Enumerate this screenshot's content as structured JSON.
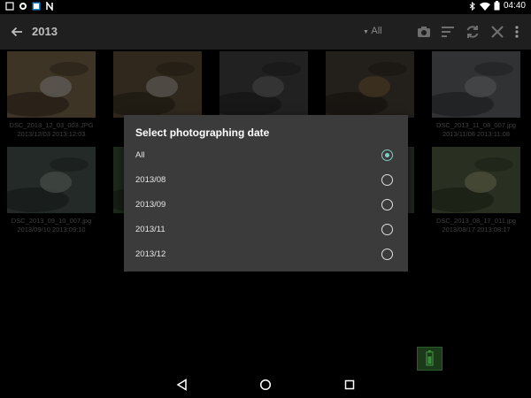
{
  "status_bar": {
    "time": "04:40",
    "left_icons": [
      "square-outline-icon",
      "cast-icon",
      "image-notification-icon",
      "nfc-icon"
    ],
    "right_icons": [
      "bluetooth-icon",
      "wifi-icon",
      "battery-icon"
    ]
  },
  "app_bar": {
    "title": "2013",
    "filter_label": "All",
    "icons": [
      "camera-icon",
      "sort-icon",
      "sync-icon",
      "close-icon",
      "more-vert-icon"
    ]
  },
  "photos": [
    {
      "file": "DSC_2013_12_03_003.JPG",
      "datetime": "2013/12/03 2013:12:03",
      "colors": [
        "#8a7452",
        "#c9c3b6",
        "#4a3c2a"
      ]
    },
    {
      "file": "",
      "datetime": "",
      "colors": [
        "#6b5a41",
        "#b8b2a6",
        "#3d3224"
      ]
    },
    {
      "file": "",
      "datetime": "",
      "colors": [
        "#4a4a4a",
        "#7a7a7a",
        "#2b2b2b"
      ]
    },
    {
      "file": "",
      "datetime": "",
      "colors": [
        "#4f463a",
        "#8a6d47",
        "#2f2a22"
      ]
    },
    {
      "file": "DSC_2013_11_08_007.jpg",
      "datetime": "2013/11/08 2013:11:08",
      "colors": [
        "#6c6f71",
        "#9aa0a3",
        "#3e4244"
      ]
    },
    {
      "file": "DSC_2013_09_10_007.jpg",
      "datetime": "2013/09/10 2013:09:10",
      "colors": [
        "#4f5d58",
        "#8e9b93",
        "#2f3a36"
      ]
    },
    {
      "file": "",
      "datetime": "",
      "colors": [
        "#435a3d",
        "#7a8d5e",
        "#2a3526"
      ]
    },
    {
      "file": "",
      "datetime": "",
      "colors": [
        "#3f4a4a",
        "#6b7a78",
        "#262d2d"
      ]
    },
    {
      "file": "",
      "datetime": "",
      "colors": [
        "#4a5546",
        "#7f8a6e",
        "#2b3129"
      ]
    },
    {
      "file": "DSC_2013_08_17_011.jpg",
      "datetime": "2013/08/17 2013:08:17",
      "colors": [
        "#5c6a4b",
        "#a3a77f",
        "#35402b"
      ]
    }
  ],
  "dialog": {
    "title": "Select photographing date",
    "options": [
      {
        "label": "All",
        "selected": true
      },
      {
        "label": "2013/08",
        "selected": false
      },
      {
        "label": "2013/09",
        "selected": false
      },
      {
        "label": "2013/11",
        "selected": false
      },
      {
        "label": "2013/12",
        "selected": false
      }
    ],
    "accent_color": "#80cbc4"
  },
  "nav_bar": {
    "icons": [
      "back-triangle-icon",
      "home-circle-icon",
      "recents-square-icon"
    ]
  }
}
